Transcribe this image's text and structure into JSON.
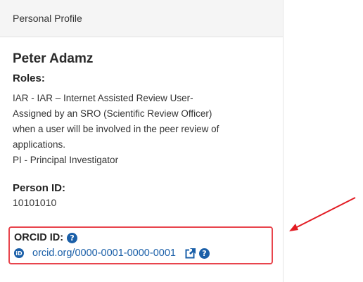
{
  "panel": {
    "header_title": "Personal Profile",
    "name": "Peter Adamz",
    "roles_label": "Roles:",
    "roles": [
      "IAR - IAR – Internet Assisted Review User-",
      "Assigned by an SRO (Scientific Review Officer)",
      "when a user will be involved in the peer review of",
      "applications.",
      "PI - Principal Investigator"
    ],
    "person_id_label": "Person ID:",
    "person_id": "10101010",
    "orcid_label": "ORCID ID:",
    "orcid_value": "orcid.org/0000-0001-0000-0001"
  },
  "icons": {
    "help": "?",
    "orcid_badge": "iD",
    "external_link": "external-link-icon"
  },
  "colors": {
    "link": "#1a5fa8",
    "highlight": "#e8454d"
  }
}
